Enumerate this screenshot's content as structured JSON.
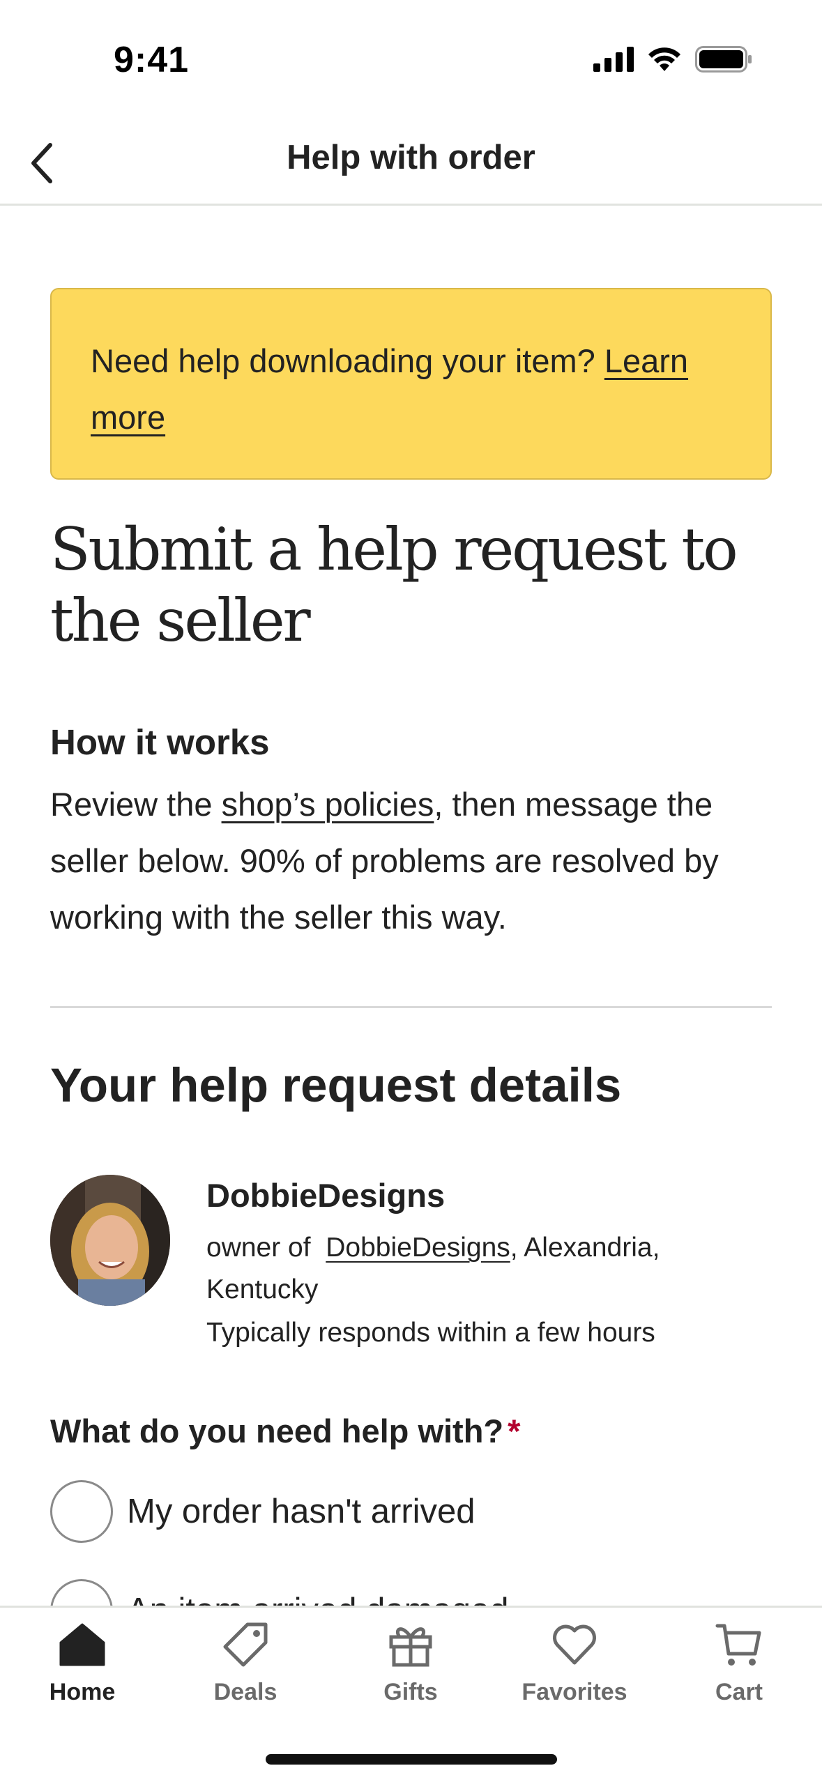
{
  "status_bar": {
    "time": "9:41"
  },
  "nav": {
    "title": "Help with order",
    "back_icon": "chevron-left-icon"
  },
  "banner": {
    "text": "Need help downloading your item?",
    "link": "Learn more",
    "background": "#fdd95c"
  },
  "main": {
    "heading": "Submit a help request to the seller",
    "how_title": "How it works",
    "how_pre": "Review the ",
    "how_link": "shop’s policies",
    "how_post": ", then message the seller below. 90% of problems are resolved by working with the seller this way.",
    "details_title": "Your help request details"
  },
  "seller": {
    "name": "DobbieDesigns",
    "owner_prefix": "owner of ",
    "shop_link": "DobbieDesigns",
    "location": ", Alexandria, Kentucky",
    "response_time": "Typically responds within a few hours"
  },
  "form": {
    "question": "What do you need help with?",
    "required_marker": "*",
    "options": [
      "My order hasn't arrived",
      "An item arrived damaged"
    ]
  },
  "tab_bar": {
    "tabs": [
      {
        "label": "Home",
        "icon": "home-icon",
        "active": true
      },
      {
        "label": "Deals",
        "icon": "tag-icon",
        "active": false
      },
      {
        "label": "Gifts",
        "icon": "gift-icon",
        "active": false
      },
      {
        "label": "Favorites",
        "icon": "heart-icon",
        "active": false
      },
      {
        "label": "Cart",
        "icon": "cart-icon",
        "active": false
      }
    ]
  }
}
